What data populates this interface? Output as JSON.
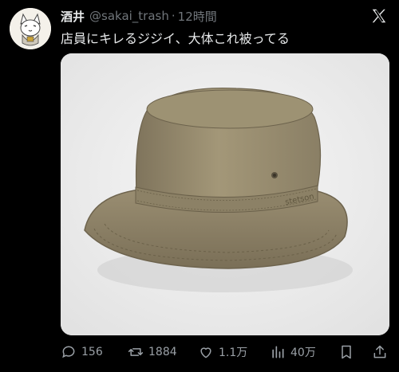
{
  "user": {
    "display_name": "酒井",
    "handle": "@sakai_trash",
    "separator": "·",
    "timestamp": "12時間"
  },
  "tweet": {
    "text": "店員にキレるジジイ、大体これ被ってる"
  },
  "media": {
    "brand_text": "stetson"
  },
  "actions": {
    "replies": "156",
    "reposts": "1884",
    "likes": "1.1万",
    "views": "40万"
  },
  "icons": {
    "platform": "x-logo-icon",
    "reply": "reply-icon",
    "repost": "repost-icon",
    "like": "heart-icon",
    "views": "views-icon",
    "bookmark": "bookmark-icon",
    "share": "share-icon"
  },
  "colors": {
    "background": "#000000",
    "primary_text": "#e7e9ea",
    "secondary_text": "#71767b",
    "hat": "#9b8f74"
  }
}
